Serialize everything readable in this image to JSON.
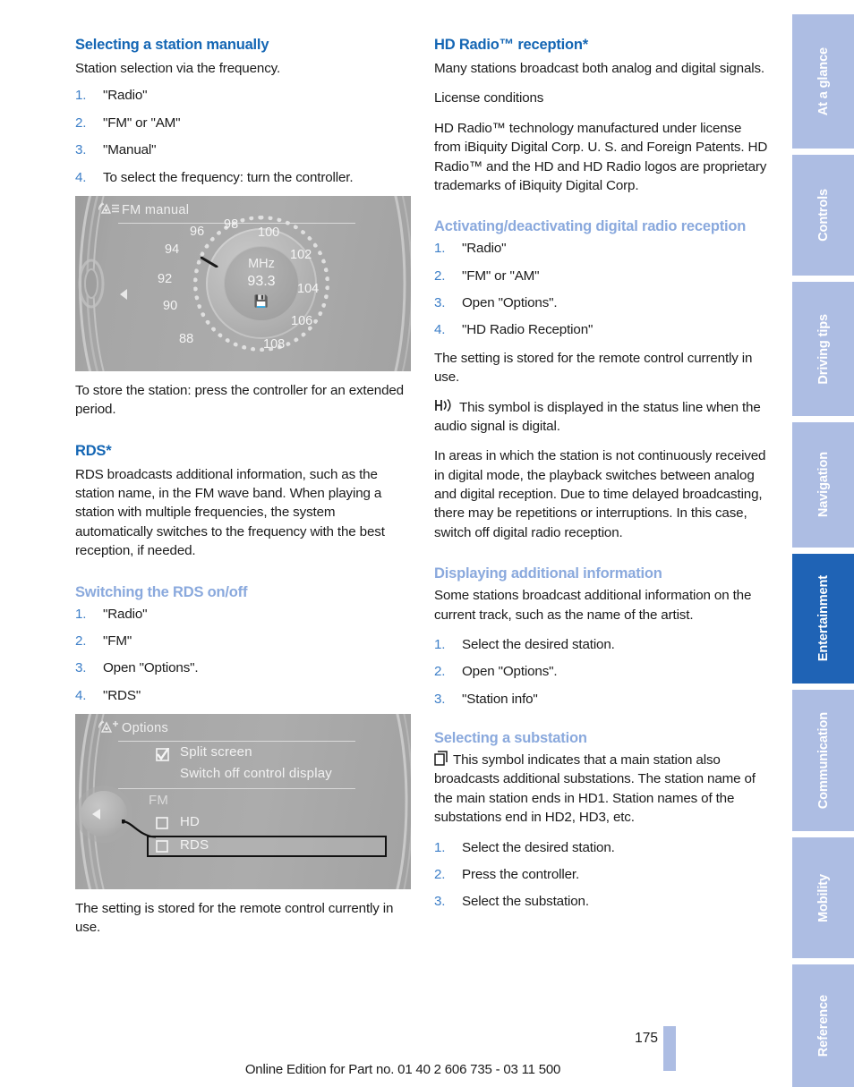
{
  "document": {
    "page_number": "175",
    "footer": "Online Edition for Part no. 01 40 2 606 735 - 03 11 500"
  },
  "left_column": {
    "section1": {
      "heading": "Selecting a station manually",
      "intro": "Station selection via the frequency.",
      "steps": [
        {
          "num": "1.",
          "text": "\"Radio\""
        },
        {
          "num": "2.",
          "text": "\"FM\" or \"AM\""
        },
        {
          "num": "3.",
          "text": "\"Manual\""
        },
        {
          "num": "4.",
          "text": "To select the frequency: turn the controller."
        }
      ],
      "figure": {
        "title": "FM manual",
        "icon": "radio-tuner-icon",
        "unit": "MHz",
        "frequency": "93.3",
        "save_icon": "store-station-icon",
        "tick_labels": [
          "88",
          "90",
          "92",
          "94",
          "96",
          "98",
          "100",
          "102",
          "104",
          "106",
          "108"
        ]
      },
      "after_figure": "To store the station: press the controller for an extended period."
    },
    "section2": {
      "heading": "RDS*",
      "body": "RDS broadcasts additional information, such as the station name, in the FM wave band. When playing a station with multiple frequencies, the system automatically switches to the frequency with the best reception, if needed."
    },
    "section3": {
      "heading": "Switching the RDS on/off",
      "steps": [
        {
          "num": "1.",
          "text": "\"Radio\""
        },
        {
          "num": "2.",
          "text": "\"FM\""
        },
        {
          "num": "3.",
          "text": "Open \"Options\"."
        },
        {
          "num": "4.",
          "text": "\"RDS\""
        }
      ],
      "figure": {
        "title": "Options",
        "icon": "radio-options-icon",
        "rows": [
          {
            "label": "Split screen",
            "checkbox": "checked"
          },
          {
            "label": "Switch off control display",
            "checkbox": "none"
          },
          {
            "label": "FM",
            "checkbox": "none"
          },
          {
            "label": "HD",
            "checkbox": "unchecked"
          },
          {
            "label": "RDS",
            "checkbox": "unchecked"
          }
        ]
      },
      "after_figure": "The setting is stored for the remote control currently in use."
    }
  },
  "right_column": {
    "section1": {
      "heading": "HD Radio™ reception*",
      "para1": "Many stations broadcast both analog and digital signals.",
      "para2": "License conditions",
      "para3": "HD Radio™ technology manufactured under license from iBiquity Digital Corp. U. S. and Foreign Patents. HD Radio™ and the HD and HD Radio logos are proprietary trademarks of iBiquity Digital Corp."
    },
    "section2": {
      "heading": "Activating/deactivating digital radio reception",
      "steps": [
        {
          "num": "1.",
          "text": "\"Radio\""
        },
        {
          "num": "2.",
          "text": "\"FM\" or \"AM\""
        },
        {
          "num": "3.",
          "text": "Open \"Options\"."
        },
        {
          "num": "4.",
          "text": "\"HD Radio Reception\""
        }
      ],
      "para1": "The setting is stored for the remote control currently in use.",
      "symbol_note": "This symbol is displayed in the status line when the audio signal is digital.",
      "symbol_icon": "hd-digital-signal-icon",
      "para2": "In areas in which the station is not continuously received in digital mode, the playback switches between analog and digital reception. Due to time delayed broadcasting, there may be repetitions or interruptions. In this case, switch off digital radio reception."
    },
    "section3": {
      "heading": "Displaying additional information",
      "para1": "Some stations broadcast additional information on the current track, such as the name of the artist.",
      "steps": [
        {
          "num": "1.",
          "text": "Select the desired station."
        },
        {
          "num": "2.",
          "text": "Open \"Options\"."
        },
        {
          "num": "3.",
          "text": "\"Station info\""
        }
      ]
    },
    "section4": {
      "heading": "Selecting a substation",
      "symbol_icon": "substation-icon",
      "symbol_note": "This symbol indicates that a main station also broadcasts additional substations. The station name of the main station ends in HD1. Station names of the substations end in HD2, HD3, etc.",
      "steps": [
        {
          "num": "1.",
          "text": "Select the desired station."
        },
        {
          "num": "2.",
          "text": "Press the controller."
        },
        {
          "num": "3.",
          "text": "Select the substation."
        }
      ]
    }
  },
  "sidebar": {
    "tabs": [
      {
        "label": "At a glance",
        "active": false
      },
      {
        "label": "Controls",
        "active": false
      },
      {
        "label": "Driving tips",
        "active": false
      },
      {
        "label": "Navigation",
        "active": false
      },
      {
        "label": "Entertainment",
        "active": true
      },
      {
        "label": "Communication",
        "active": false
      },
      {
        "label": "Mobility",
        "active": false
      },
      {
        "label": "Reference",
        "active": false
      }
    ],
    "colors": {
      "inactive": "#adbde3",
      "active": "#1f63b5",
      "label": "#ffffff"
    }
  },
  "colors": {
    "heading_primary": "#1466b4",
    "heading_secondary": "#8aa9dd",
    "step_number": "#3d7fc8",
    "body_text": "#1b1b1b",
    "figure_bg": "#a6a6a6"
  }
}
